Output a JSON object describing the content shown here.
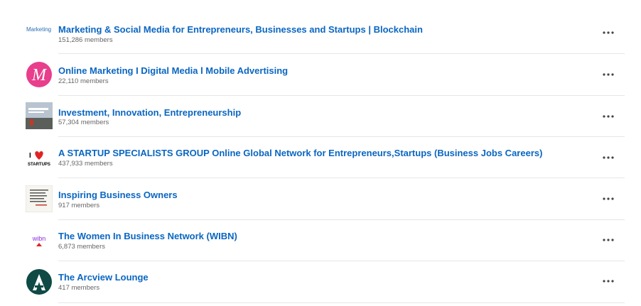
{
  "groups": [
    {
      "name": "Marketing & Social Media for Entrepreneurs, Businesses and Startups | Blockchain",
      "members": "151,286 members",
      "logo_text": "Marketing"
    },
    {
      "name": "Online Marketing I Digital Media l Mobile Advertising",
      "members": "22,110 members",
      "logo_text": "M"
    },
    {
      "name": "Investment, Innovation, Entrepreneurship",
      "members": "57,304 members"
    },
    {
      "name": "A STARTUP SPECIALISTS GROUP Online Global Network for Entrepreneurs,Startups (Business Jobs Careers)",
      "members": "437,933 members",
      "logo_text_top": "I",
      "logo_text_bottom": "STARTUPS"
    },
    {
      "name": "Inspiring Business Owners",
      "members": "917 members"
    },
    {
      "name": "The Women In Business Network (WIBN)",
      "members": "6,873 members",
      "logo_text": "wibn"
    },
    {
      "name": "The Arcview Lounge",
      "members": "417 members"
    }
  ],
  "icons": {
    "more": "ellipsis-icon"
  },
  "colors": {
    "link": "#0a66c2",
    "meta": "#666666",
    "divider": "#e6e6e6"
  }
}
